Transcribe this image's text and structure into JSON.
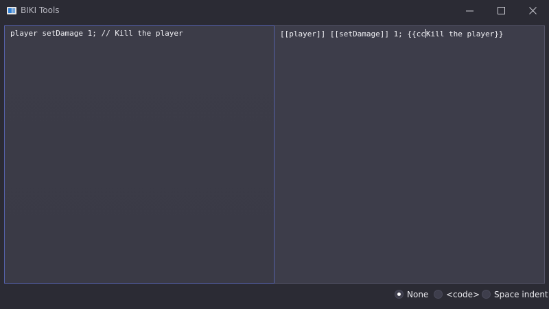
{
  "window": {
    "title": "BIKI Tools"
  },
  "editors": {
    "input_text": "player setDamage 1; // Kill the player",
    "output_before_caret": "[[player]] [[setDamage]] 1; {{cc",
    "output_after_caret": "Kill the player}}"
  },
  "options": {
    "selected": "None",
    "items": [
      {
        "label": "None",
        "checked": true
      },
      {
        "label": "<code>",
        "checked": false
      },
      {
        "label": "Space indent",
        "checked": false
      }
    ]
  },
  "icons": {
    "app": "biki-tools-app-icon",
    "minimize": "minimize-icon",
    "maximize": "maximize-icon",
    "close": "close-icon"
  }
}
